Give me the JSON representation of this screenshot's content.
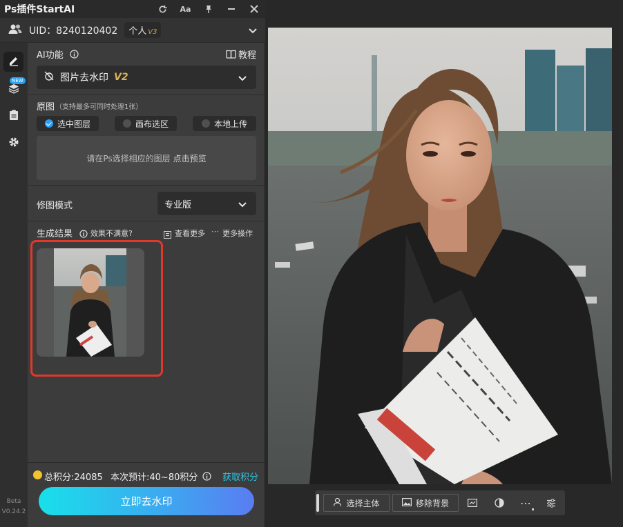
{
  "app": {
    "title": "Ps插件StartAI"
  },
  "titlebar_icons": [
    "refresh-icon",
    "font-size-icon",
    "pin-icon",
    "minimize-icon",
    "close-icon"
  ],
  "user": {
    "uid_label": "UID：8240120402",
    "plan": "个人",
    "plan_version": "V3"
  },
  "sidebar": {
    "new_tag": "NEW",
    "version_line1": "Beta",
    "version_line2": "V0.24.2"
  },
  "ai": {
    "label": "AI功能",
    "tutorial": "教程",
    "feature": "图片去水印",
    "feature_version": "V2"
  },
  "source": {
    "label": "原图",
    "hint": "（支持最多可同时处理1张）",
    "options": [
      "选中图层",
      "画布选区",
      "本地上传"
    ],
    "selected": 0,
    "preview_text": "请在Ps选择相应的图层",
    "preview_link": "点击预览"
  },
  "mode": {
    "label": "修图模式",
    "value": "专业版"
  },
  "result": {
    "label": "生成结果",
    "feedback": "效果不满意?",
    "more_view": "查看更多",
    "more_ops": "更多操作"
  },
  "footer": {
    "points": "总积分:24085",
    "estimate": "本次预计:40~80积分",
    "get_points": "获取积分",
    "cta": "立即去水印"
  },
  "toolbar": {
    "select_subject": "选择主体",
    "remove_bg": "移除背景"
  },
  "colors": {
    "accent": "#2b9ef5",
    "highlight_border": "#e5362a",
    "link": "#2ec5e6"
  }
}
